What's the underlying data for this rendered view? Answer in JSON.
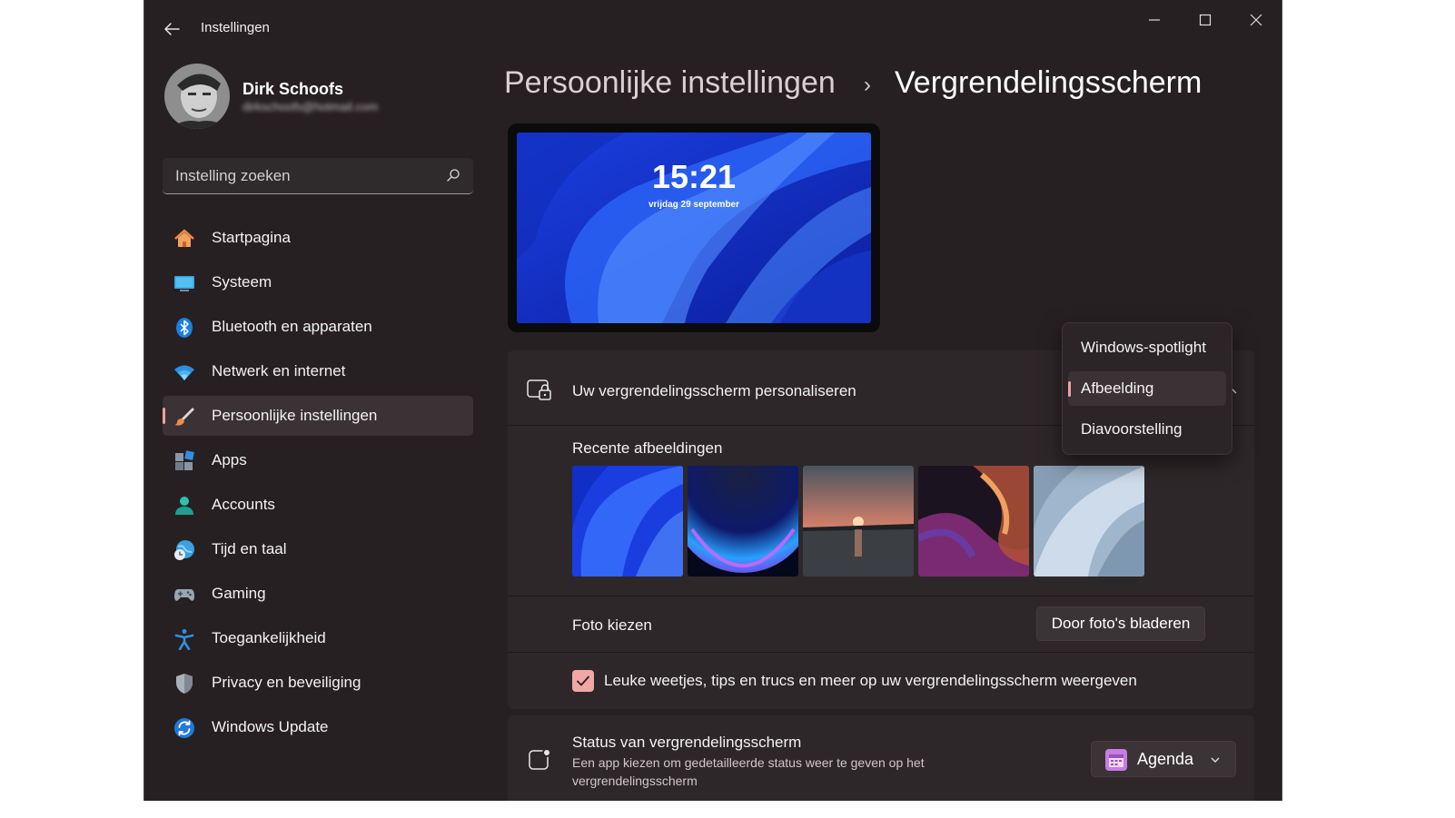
{
  "window": {
    "title": "Instellingen",
    "controls": [
      "minimize",
      "maximize",
      "close"
    ]
  },
  "profile": {
    "name": "Dirk Schoofs",
    "email": "dirkschoofs@hotmail.com"
  },
  "search": {
    "placeholder": "Instelling zoeken"
  },
  "sidebar": {
    "items": [
      {
        "label": "Startpagina",
        "icon": "home-icon"
      },
      {
        "label": "Systeem",
        "icon": "monitor-icon"
      },
      {
        "label": "Bluetooth en apparaten",
        "icon": "bluetooth-icon"
      },
      {
        "label": "Netwerk en internet",
        "icon": "wifi-icon"
      },
      {
        "label": "Persoonlijke instellingen",
        "icon": "paintbrush-icon",
        "active": true
      },
      {
        "label": "Apps",
        "icon": "apps-icon"
      },
      {
        "label": "Accounts",
        "icon": "person-icon"
      },
      {
        "label": "Tijd en taal",
        "icon": "globe-clock-icon"
      },
      {
        "label": "Gaming",
        "icon": "gamepad-icon"
      },
      {
        "label": "Toegankelijkheid",
        "icon": "accessibility-icon"
      },
      {
        "label": "Privacy en beveiliging",
        "icon": "shield-icon"
      },
      {
        "label": "Windows Update",
        "icon": "update-icon"
      }
    ]
  },
  "breadcrumb": {
    "parent": "Persoonlijke instellingen",
    "separator": "›",
    "current": "Vergrendelingsscherm"
  },
  "preview": {
    "time": "15:21",
    "date": "vrijdag 29 september"
  },
  "personalize": {
    "title": "Uw vergrendelingsscherm personaliseren",
    "recent_label": "Recente afbeeldingen",
    "thumbnails": [
      "bloom-blue",
      "glow-orb",
      "sunset-lake",
      "purple-ribbon",
      "light-bloom"
    ],
    "choose_photo_label": "Foto kiezen",
    "browse_button": "Door foto's bladeren",
    "tips_label": "Leuke weetjes, tips en trucs en meer op uw vergrendelingsscherm weergeven",
    "tips_checked": true
  },
  "dropdown": {
    "options": [
      "Windows-spotlight",
      "Afbeelding",
      "Diavoorstelling"
    ],
    "selected": "Afbeelding"
  },
  "status": {
    "title": "Status van vergrendelingsscherm",
    "description": "Een app kiezen om gedetailleerde status weer te geven op het vergrendelingsscherm",
    "value": "Agenda"
  },
  "colors": {
    "background": "#272022",
    "card": "#2e2729",
    "accent": "#f0a7a6"
  }
}
